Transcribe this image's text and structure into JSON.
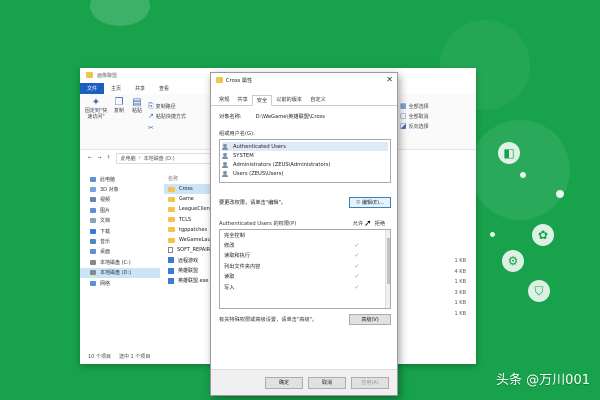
{
  "background": {
    "accent": "#17a24b"
  },
  "watermark": "头条 @万川001",
  "explorer": {
    "title": "画像聯盟",
    "tabs": [
      "文件",
      "主页",
      "共享",
      "查看"
    ],
    "ribbon": {
      "pin_label": "固定到\"快速访问\"",
      "copy_label": "复制",
      "paste_label": "粘贴",
      "copy_path_label": "复制路径",
      "paste_shortcut_label": "粘贴快捷方式",
      "select_all_label": "全部选择",
      "select_none_label": "全部取消",
      "invert_label": "反向选择"
    },
    "breadcrumb": [
      "此电脑",
      "本地磁盘 (D:)"
    ],
    "nav_items": [
      {
        "label": "此电脑",
        "color": "#5b8fd6"
      },
      {
        "label": "3D 对象",
        "color": "#6fa8dc"
      },
      {
        "label": "视频",
        "color": "#6f7fb0"
      },
      {
        "label": "图片",
        "color": "#5b8fd6"
      },
      {
        "label": "文档",
        "color": "#8aa0bf"
      },
      {
        "label": "下载",
        "color": "#3c78d8"
      },
      {
        "label": "音乐",
        "color": "#4a86c8"
      },
      {
        "label": "桌面",
        "color": "#5b8fd6"
      },
      {
        "label": "本地磁盘 (C:)",
        "color": "#888888"
      },
      {
        "label": "本地磁盘 (D:)",
        "color": "#888888"
      },
      {
        "label": "网络",
        "color": "#5b8fd6"
      }
    ],
    "column_name": "名称",
    "files": [
      {
        "name": "Cross",
        "kind": "folder"
      },
      {
        "name": "Game",
        "kind": "folder"
      },
      {
        "name": "LeagueClient",
        "kind": "folder"
      },
      {
        "name": "TCLS",
        "kind": "folder"
      },
      {
        "name": "tgppatches",
        "kind": "folder"
      },
      {
        "name": "WeGameLauncher",
        "kind": "folder"
      },
      {
        "name": "SOFT_REPAIR",
        "kind": "file"
      },
      {
        "name": "远程游戏",
        "kind": "app"
      },
      {
        "name": "英雄联盟",
        "kind": "app"
      },
      {
        "name": "英雄联盟.exe",
        "kind": "app"
      }
    ],
    "sizes": [
      "1 KB",
      "4 KB",
      "1 KB",
      "3 KB",
      "1 KB",
      "1 KB"
    ],
    "status": [
      "10 个项目",
      "选中 1 个项目"
    ]
  },
  "dialog": {
    "title": "Cross 属性",
    "tabs": [
      "常规",
      "共享",
      "安全",
      "以前的版本",
      "自定义"
    ],
    "active_tab": "安全",
    "object_label": "对象名称:",
    "object_value": "D:\\WeGame\\英雄联盟\\Cross",
    "principals_label": "组或用户名(G):",
    "principals": [
      "Authenticated Users",
      "SYSTEM",
      "Administrators (ZEUS\\Administrators)",
      "Users (ZEUS\\Users)"
    ],
    "edit_hint": "要更改权限，请单击\"编辑\"。",
    "edit_button": "编辑(E)...",
    "perm_label": "Authenticated Users 的权限(P)",
    "allow_label": "允许",
    "deny_label": "拒绝",
    "permissions": [
      {
        "name": "完全控制",
        "allow": ""
      },
      {
        "name": "修改",
        "allow": "✓"
      },
      {
        "name": "读取和执行",
        "allow": "✓"
      },
      {
        "name": "列出文件夹内容",
        "allow": "✓"
      },
      {
        "name": "读取",
        "allow": "✓"
      },
      {
        "name": "写入",
        "allow": "✓"
      }
    ],
    "advanced_hint": "有关特殊权限或高级设置，请单击\"高级\"。",
    "advanced_button": "高级(V)",
    "ok_button": "确定",
    "cancel_button": "取消",
    "apply_button": "应用(A)"
  }
}
